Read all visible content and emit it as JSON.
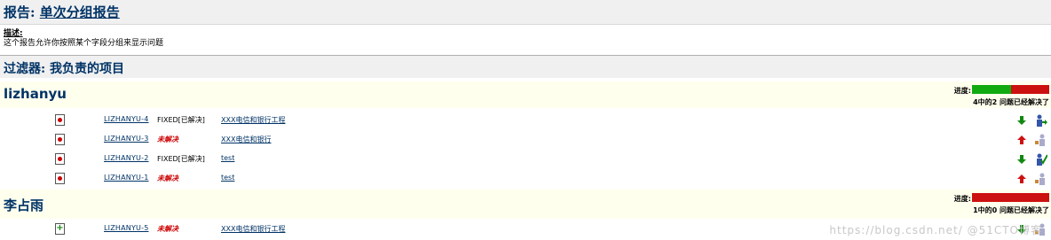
{
  "report": {
    "label": "报告:",
    "name": "单次分组报告",
    "description_label": "描述:",
    "description": "这个报告允许你按照某个字段分组来显示问题"
  },
  "filter": {
    "label": "过滤器:",
    "name": "我负责的项目"
  },
  "progress_label": "进度:",
  "groups": [
    {
      "name": "lizhanyu",
      "progress_fraction": 0.5,
      "progress_text": "4中的2 问题已经解决了",
      "issues": [
        {
          "key": "LIZHANYU-4",
          "resolution": "FIXED[已解决]",
          "unresolved": false,
          "summary": "XXX电信和银行工程",
          "type_icon": "bug-icon",
          "priority_icon": "priority-down-arrow-icon",
          "assignee_icon": "user-arrow-icon"
        },
        {
          "key": "LIZHANYU-3",
          "resolution": "未解决",
          "unresolved": true,
          "summary": "XXX电信和银行",
          "type_icon": "bug-icon",
          "priority_icon": "priority-up-arrow-icon",
          "assignee_icon": "user-assign-icon"
        },
        {
          "key": "LIZHANYU-2",
          "resolution": "FIXED[已解决]",
          "unresolved": false,
          "summary": "test",
          "type_icon": "bug-icon",
          "priority_icon": "priority-down-arrow-icon",
          "assignee_icon": "user-check-icon"
        },
        {
          "key": "LIZHANYU-1",
          "resolution": "未解决",
          "unresolved": true,
          "summary": "test",
          "type_icon": "bug-icon",
          "priority_icon": "priority-up-arrow-icon",
          "assignee_icon": "user-assign-icon"
        }
      ]
    },
    {
      "name": "李占雨",
      "progress_fraction": 0,
      "progress_text": "1中的0 问题已经解决了",
      "issues": [
        {
          "key": "LIZHANYU-5",
          "resolution": "未解决",
          "unresolved": true,
          "summary": "XXX电信和银行工程",
          "type_icon": "new-feature-icon",
          "priority_icon": "priority-down-arrow-icon",
          "assignee_icon": "user-assign-icon"
        }
      ]
    }
  ],
  "watermark": "https://blog.csdn.net/ @51CTO博客",
  "colors": {
    "title": "#003366",
    "resolved_bar": "#11aa11",
    "unresolved_bar": "#cc1111",
    "group_bg": "#ffffee",
    "header_bg": "#f0f0f0"
  }
}
